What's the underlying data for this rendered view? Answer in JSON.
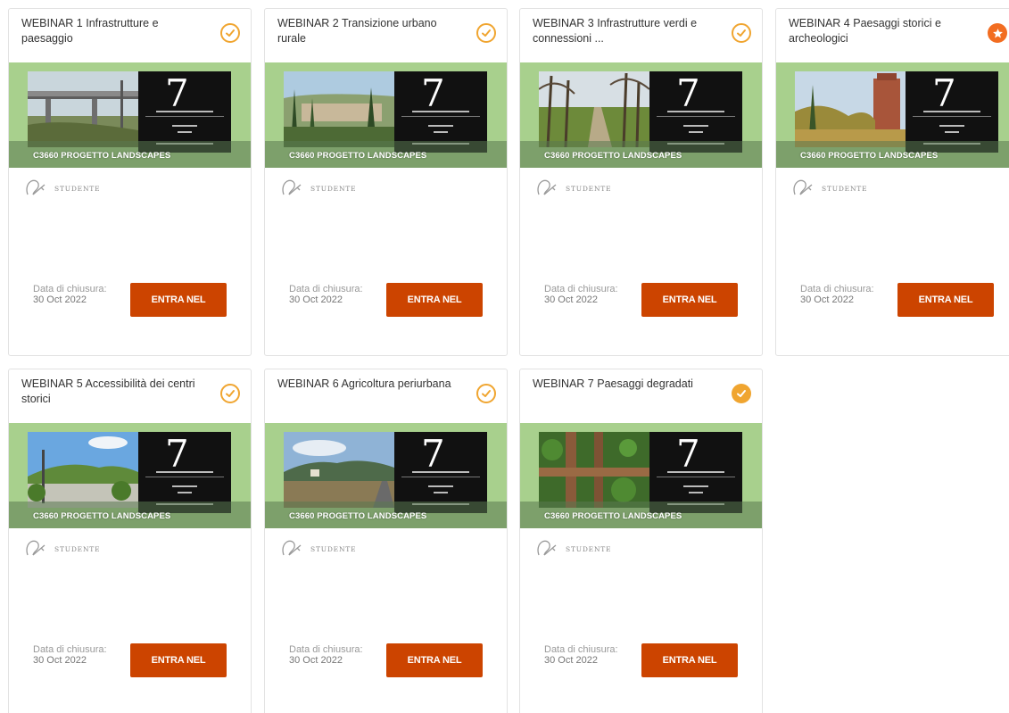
{
  "course_label": "C3660 PROGETTO LANDSCAPES",
  "role_label": "STUDENTE",
  "closing_label": "Data di chiusura:",
  "closing_date": "30 Oct  2022",
  "button_label": "ENTRA NEL",
  "poster_number": "7",
  "colors": {
    "accent": "#cc4400",
    "status_orange": "#f0a530",
    "star_orange": "#f26d21",
    "banner_green": "#a8d08d"
  },
  "cards": [
    {
      "title": "WEBINAR 1 Infrastrutture e paesaggio",
      "status_icon": "check-outline-icon"
    },
    {
      "title": "WEBINAR 2 Transizione urbano rurale",
      "status_icon": "check-outline-icon"
    },
    {
      "title": "WEBINAR 3 Infrastrutture verdi e connessioni ...",
      "status_icon": "check-outline-icon"
    },
    {
      "title": "WEBINAR 4 Paesaggi storici e archeologici",
      "status_icon": "star-filled-icon"
    },
    {
      "title": "WEBINAR 5 Accessibilità dei centri storici",
      "status_icon": "check-outline-icon"
    },
    {
      "title": "WEBINAR 6 Agricoltura periurbana",
      "status_icon": "check-outline-icon"
    },
    {
      "title": "WEBINAR 7 Paesaggi degradati",
      "status_icon": "check-filled-icon"
    }
  ]
}
